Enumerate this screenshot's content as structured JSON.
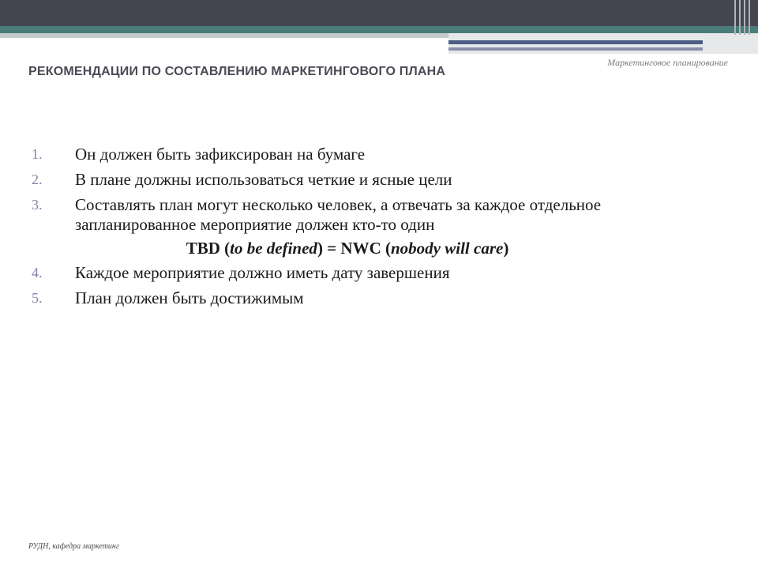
{
  "header": {
    "corner_label": "Маркетинговое планирование",
    "title": "РЕКОМЕНДАЦИИ ПО СОСТАВЛЕНИЮ МАРКЕТИНГОВОГО ПЛАНА"
  },
  "list": {
    "items": [
      {
        "num": "1.",
        "text": "Он должен быть зафиксирован на бумаге"
      },
      {
        "num": "2.",
        "text": "В плане должны использоваться четкие и ясные цели"
      },
      {
        "num": "3.",
        "text": "Составлять план могут несколько человек, а отвечать за каждое отдельное запланированное мероприятие должен кто-то один"
      },
      {
        "num": "4.",
        "text": "Каждое мероприятие должно иметь дату завершения"
      },
      {
        "num": "5.",
        "text": "План должен быть достижимым"
      }
    ],
    "highlight": {
      "part1": "TBD (",
      "part2": "to be defined",
      "part3": ") = NWC (",
      "part4": "nobody will care",
      "part5": ")"
    }
  },
  "footer": {
    "text": "РУДН, кафедра маркетинг"
  },
  "colors": {
    "top_bar": "#454552",
    "teal_band": "#4a7c7a",
    "number_color": "#8e7ea8",
    "accent_line": "#4c5e86"
  }
}
